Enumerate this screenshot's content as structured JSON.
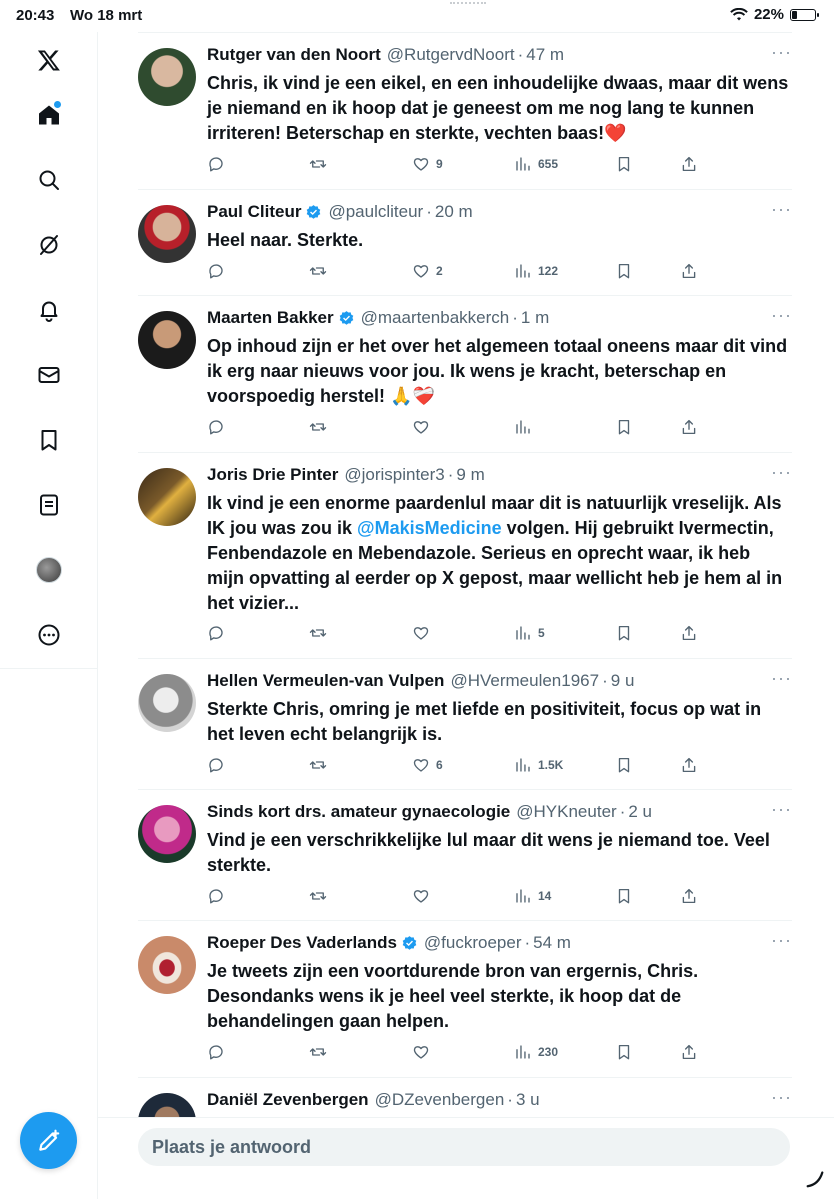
{
  "status_bar": {
    "time": "20:43",
    "date": "Wo 18 mrt",
    "battery": "22%",
    "battery_level": 0.22
  },
  "nav": {
    "items": [
      {
        "icon": "x-logo-icon"
      },
      {
        "icon": "home-icon",
        "has_dot": true
      },
      {
        "icon": "search-icon"
      },
      {
        "icon": "grok-icon"
      },
      {
        "icon": "bell-icon"
      },
      {
        "icon": "mail-icon"
      },
      {
        "icon": "bookmark-icon"
      },
      {
        "icon": "list-icon"
      },
      {
        "icon": "profile-avatar"
      },
      {
        "icon": "more-circle-icon"
      }
    ],
    "compose_icon": "compose-icon"
  },
  "accent_color": "#1d9bf0",
  "tweets": [
    {
      "name": "Rutger van den Noort",
      "verified": false,
      "handle": "@RutgervdNoort",
      "time": "47 m",
      "text": "Chris, ik vind je een eikel, en een inhoudelijke dwaas, maar dit wens je niemand en ik hoop dat je geneest om me nog lang te kunnen irriteren! Beterschap en sterkte, vechten baas!❤️",
      "replies": "",
      "retweets": "",
      "likes": "9",
      "views": "655"
    },
    {
      "name": "Paul Cliteur",
      "verified": true,
      "handle": "@paulcliteur",
      "time": "20 m",
      "text": "Heel naar. Sterkte.",
      "replies": "",
      "retweets": "",
      "likes": "2",
      "views": "122"
    },
    {
      "name": "Maarten Bakker",
      "verified": true,
      "handle": "@maartenbakkerch",
      "time": "1 m",
      "text": "Op inhoud zijn er het over het algemeen totaal oneens maar dit vind ik erg naar nieuws voor jou. Ik wens je kracht, beterschap en voorspoedig herstel! 🙏❤️‍🩹",
      "replies": "",
      "retweets": "",
      "likes": "",
      "views": ""
    },
    {
      "name": "Joris Drie Pinter",
      "verified": false,
      "handle": "@jorispinter3",
      "time": "9 m",
      "text_before": "Ik vind je een enorme paardenlul maar dit is natuurlijk vreselijk. Als IK jou was zou ik ",
      "mention": "@MakisMedicine",
      "text_after": " volgen. Hij gebruikt Ivermectin, Fenbendazole en Mebendazole. Serieus en oprecht waar, ik heb mijn opvatting al eerder op X gepost, maar wellicht heb je hem al in het vizier...",
      "replies": "",
      "retweets": "",
      "likes": "",
      "views": "5"
    },
    {
      "name": "Hellen Vermeulen-van Vulpen",
      "verified": false,
      "handle": "@HVermeulen1967",
      "time": "9 u",
      "text": "Sterkte Chris, omring je met liefde en positiviteit, focus op wat in het leven echt belangrijk is.",
      "replies": "",
      "retweets": "",
      "likes": "6",
      "views": "1.5K"
    },
    {
      "name": "Sinds kort drs. amateur gynaecologie",
      "verified": false,
      "handle": "@HYKneuter",
      "time": "2 u",
      "text": "Vind je een verschrikkelijke lul maar dit wens je niemand toe. Veel sterkte.",
      "replies": "",
      "retweets": "",
      "likes": "",
      "views": "14"
    },
    {
      "name": "Roeper Des Vaderlands",
      "verified": true,
      "handle": "@fuckroeper",
      "time": "54 m",
      "text": "Je tweets zijn een voortdurende bron van ergernis, Chris. Desondanks wens ik je heel veel sterkte, ik hoop dat de behandelingen gaan helpen.",
      "replies": "",
      "retweets": "",
      "likes": "",
      "views": "230"
    },
    {
      "name": "Daniël Zevenbergen",
      "verified": false,
      "handle": "@DZevenbergen",
      "time": "3 u",
      "text": "",
      "replies": "",
      "retweets": "",
      "likes": "",
      "views": ""
    }
  ],
  "reply": {
    "placeholder": "Plaats je antwoord"
  }
}
